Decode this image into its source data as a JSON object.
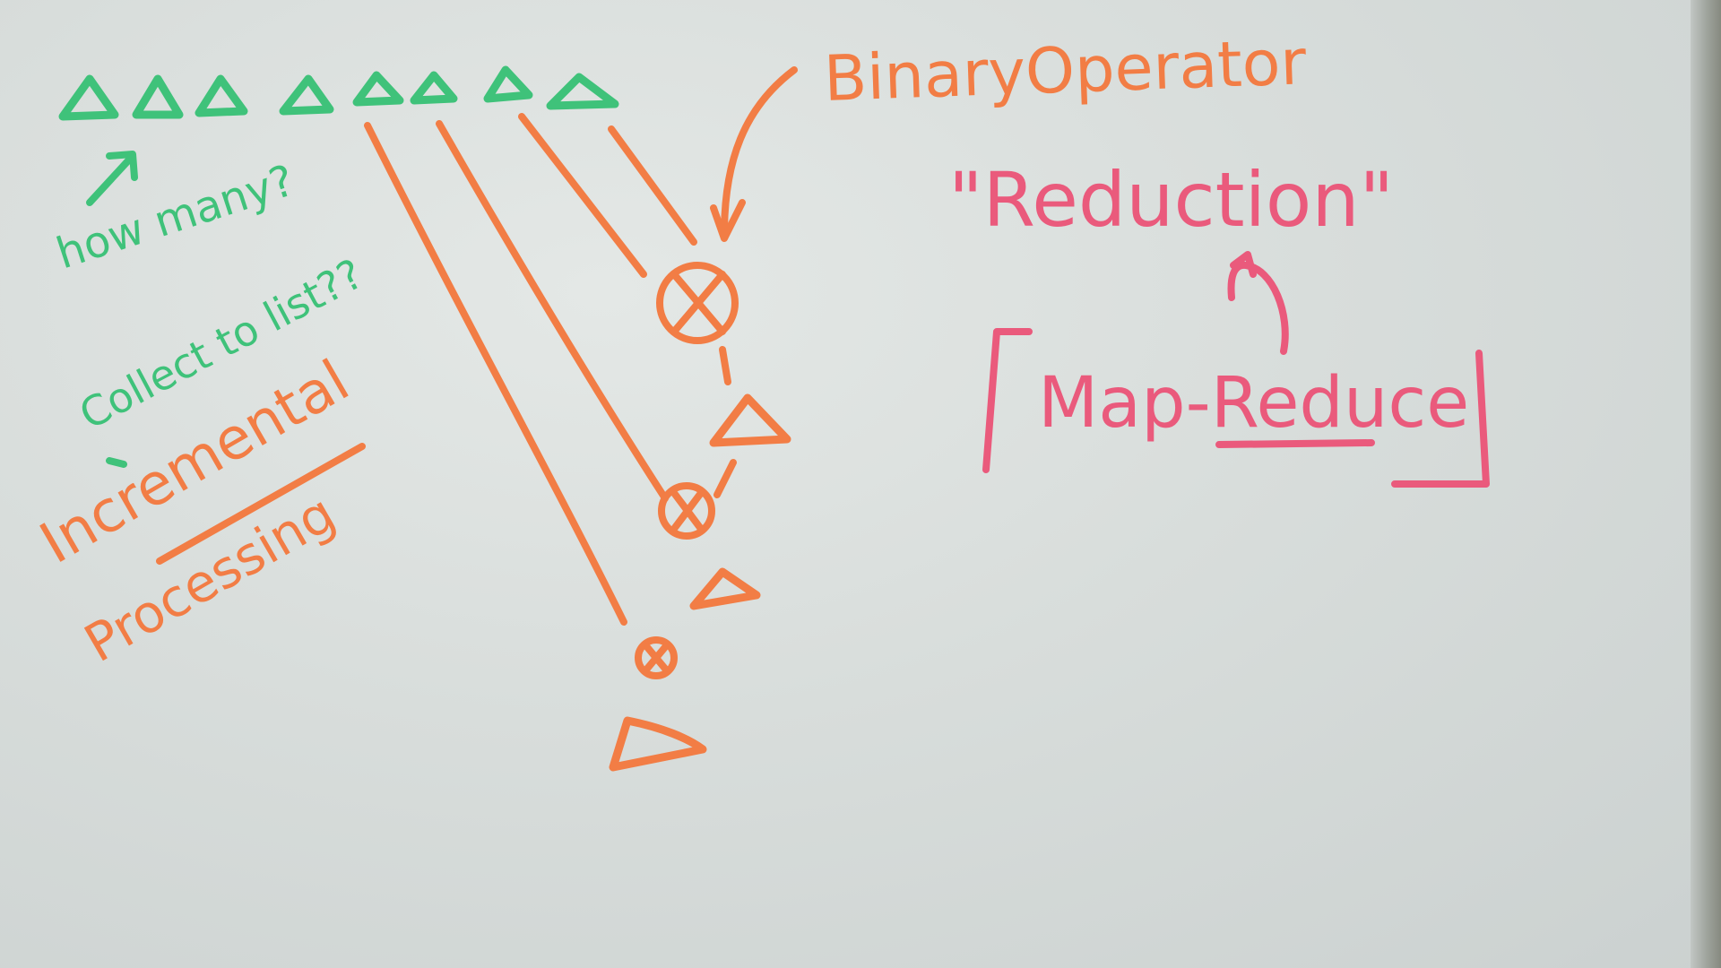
{
  "board": {
    "colors": {
      "green_marker": "#3fc27a",
      "orange_marker": "#f27d45",
      "pink_marker": "#ea5a7c",
      "board_surface": "#dde2e0"
    }
  },
  "notes": {
    "binary_operator": "BinaryOperator",
    "reduction": "\"Reduction\"",
    "map_reduce": "Map-Reduce",
    "how_many": "how many?",
    "collect_to_list": "Collect to list??",
    "incremental": "Incremental",
    "processing": "Processing"
  },
  "symbols": {
    "element_icon": "triangle",
    "operator_icon": "circled-x"
  }
}
